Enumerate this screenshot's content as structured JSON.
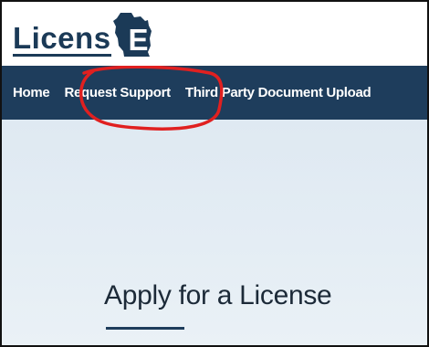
{
  "header": {
    "logo_text": "Licens",
    "logo_mark_letter": "E",
    "logo_mark_icon": "wisconsin-state-icon",
    "logo_color": "#1b3a57"
  },
  "nav": {
    "background": "#1e3d5c",
    "items": [
      {
        "label": "Home"
      },
      {
        "label": "Request Support"
      },
      {
        "label": "Third Party Document Upload"
      }
    ]
  },
  "hero": {
    "title": "Apply for a License"
  },
  "annotation": {
    "shape": "freehand-circle",
    "color": "#e02020",
    "target": "Request Support"
  }
}
